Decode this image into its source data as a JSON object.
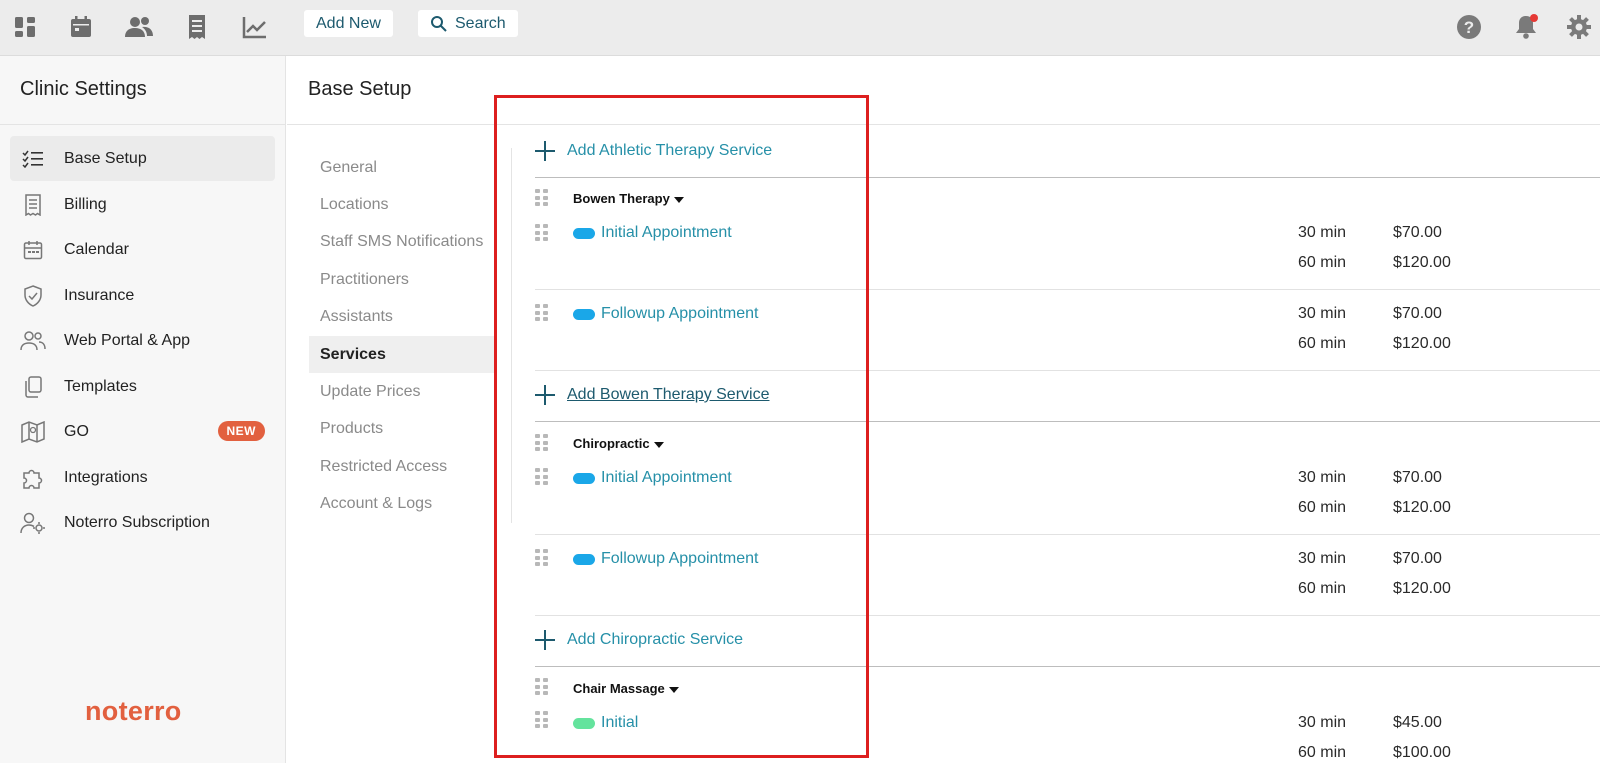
{
  "topbar": {
    "icons": [
      "dashboard-icon",
      "calendar-icon",
      "people-icon",
      "receipt-icon",
      "chart-icon"
    ],
    "add_new_label": "Add New",
    "search_label": "Search",
    "right_icons": [
      "help-icon",
      "bell-icon",
      "gear-icon"
    ],
    "notification_dot_color": "#e53935"
  },
  "sidebar": {
    "title": "Clinic Settings",
    "items": [
      {
        "label": "Base Setup",
        "icon": "checklist-icon",
        "active": true
      },
      {
        "label": "Billing",
        "icon": "receipt-icon"
      },
      {
        "label": "Calendar",
        "icon": "calendar-icon"
      },
      {
        "label": "Insurance",
        "icon": "shield-icon"
      },
      {
        "label": "Web Portal & App",
        "icon": "people-icon"
      },
      {
        "label": "Templates",
        "icon": "copy-icon"
      },
      {
        "label": "GO",
        "icon": "map-icon",
        "badge": "NEW"
      },
      {
        "label": "Integrations",
        "icon": "puzzle-icon"
      },
      {
        "label": "Noterro Subscription",
        "icon": "user-gear-icon"
      }
    ],
    "logo_text": "noterro"
  },
  "main": {
    "title": "Base Setup",
    "subnav": [
      {
        "label": "General"
      },
      {
        "label": "Locations"
      },
      {
        "label": "Staff SMS Notifications"
      },
      {
        "label": "Practitioners"
      },
      {
        "label": "Assistants"
      },
      {
        "label": "Services",
        "active": true
      },
      {
        "label": "Update Prices"
      },
      {
        "label": "Products"
      },
      {
        "label": "Restricted Access"
      },
      {
        "label": "Account & Logs"
      }
    ]
  },
  "services": {
    "add_athletic": "Add Athletic Therapy Service",
    "categories": [
      {
        "name": "Bowen Therapy",
        "services": [
          {
            "name": "Initial Appointment",
            "color": "#1aa7e8",
            "options": [
              {
                "duration": "30 min",
                "price": "$70.00"
              },
              {
                "duration": "60 min",
                "price": "$120.00"
              }
            ]
          },
          {
            "name": "Followup Appointment",
            "color": "#1aa7e8",
            "options": [
              {
                "duration": "30 min",
                "price": "$70.00"
              },
              {
                "duration": "60 min",
                "price": "$120.00"
              }
            ]
          }
        ],
        "add_label": "Add Bowen Therapy Service"
      },
      {
        "name": "Chiropractic",
        "services": [
          {
            "name": "Initial Appointment",
            "color": "#1aa7e8",
            "options": [
              {
                "duration": "30 min",
                "price": "$70.00"
              },
              {
                "duration": "60 min",
                "price": "$120.00"
              }
            ]
          },
          {
            "name": "Followup Appointment",
            "color": "#1aa7e8",
            "options": [
              {
                "duration": "30 min",
                "price": "$70.00"
              },
              {
                "duration": "60 min",
                "price": "$120.00"
              }
            ]
          }
        ],
        "add_label": "Add Chiropractic Service"
      },
      {
        "name": "Chair Massage",
        "services": [
          {
            "name": "Initial",
            "color": "#64e39d",
            "options": [
              {
                "duration": "30 min",
                "price": "$45.00"
              },
              {
                "duration": "60 min",
                "price": "$100.00"
              }
            ]
          }
        ]
      }
    ]
  },
  "colors": {
    "accent": "#2690a8",
    "highlight_box": "#dd1f1f",
    "badge": "#e2603f"
  }
}
